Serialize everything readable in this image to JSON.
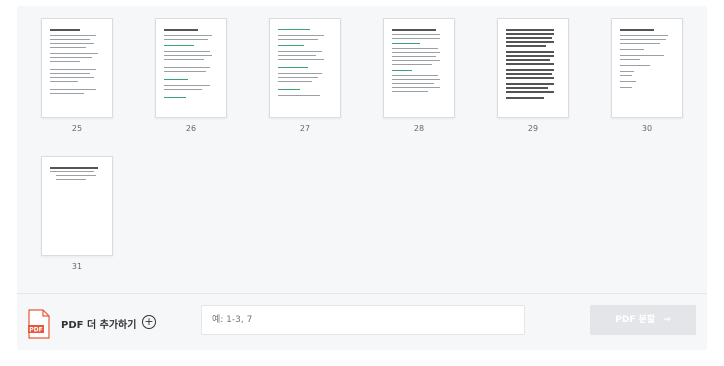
{
  "pages": [
    {
      "number": "25"
    },
    {
      "number": "26"
    },
    {
      "number": "27"
    },
    {
      "number": "28"
    },
    {
      "number": "29"
    },
    {
      "number": "30"
    },
    {
      "number": "31"
    }
  ],
  "toolbar": {
    "add_pdf_label": "PDF 더 추가하기",
    "add_icon": "plus-circle-icon",
    "range_placeholder": "예: 1-3, 7",
    "split_label": "PDF 분할",
    "split_icon": "arrow-right-icon"
  },
  "colors": {
    "accent_red": "#e8583a",
    "teal": "#3aa37a",
    "disabled": "#e3e5e8"
  }
}
